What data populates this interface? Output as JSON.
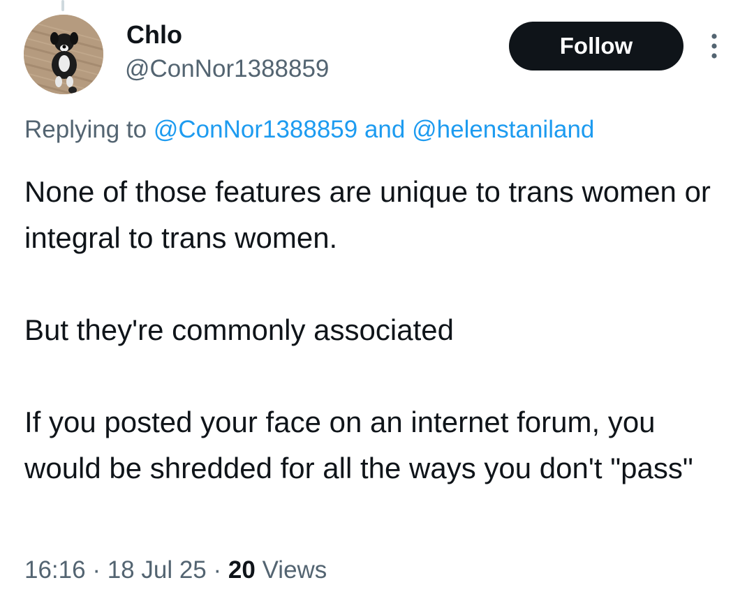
{
  "author": {
    "display_name": "Chlo",
    "handle": "@ConNor1388859",
    "avatar_icon": "dog-photo-avatar"
  },
  "actions": {
    "follow_label": "Follow",
    "more_icon": "vertical-ellipsis-icon"
  },
  "reply_context": {
    "prefix": "Replying to",
    "mention_1": "@ConNor1388859",
    "conjunction": "and",
    "mention_2": "@helenstaniland"
  },
  "tweet": {
    "paragraphs": [
      "None of those features are unique to trans women or integral to trans women.",
      "But they're commonly associated",
      "If you posted your face on an internet forum, you would be shredded for all the ways you don't \"pass\""
    ]
  },
  "meta": {
    "time": "16:16",
    "separator": "·",
    "date": "18 Jul 25",
    "views_count": "20",
    "views_label": "Views"
  },
  "colors": {
    "text_primary": "#0f1419",
    "text_secondary": "#536471",
    "link": "#1d9bf0",
    "button_bg": "#0f1419"
  }
}
